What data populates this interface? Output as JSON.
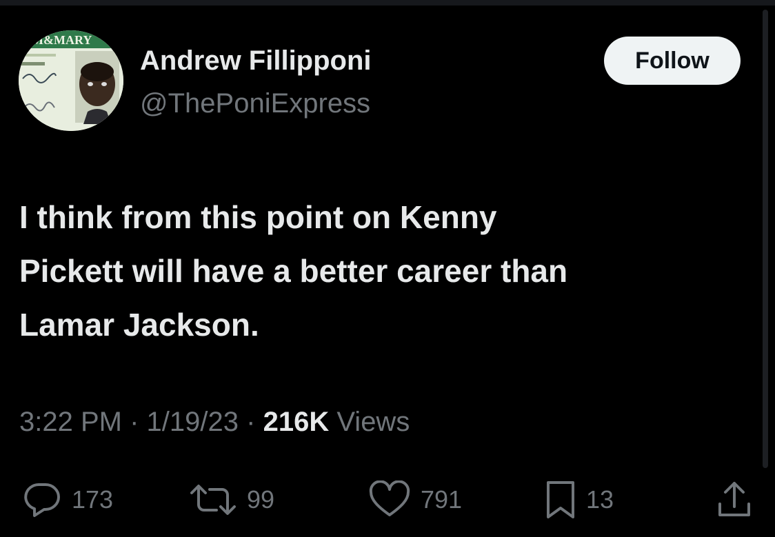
{
  "author": {
    "name": "Andrew Fillipponi",
    "handle": "@ThePoniExpress"
  },
  "avatar_card_text": "AM&MARY",
  "follow_label": "Follow",
  "tweet": {
    "text_lines": [
      "I think from this point on Kenny",
      "Pickett will have a better career than",
      "Lamar Jackson."
    ]
  },
  "meta": {
    "time": "3:22 PM",
    "separator": "·",
    "date": "1/19/23",
    "views_count": "216K",
    "views_label": "Views"
  },
  "actions": {
    "replies": "173",
    "reposts": "99",
    "likes": "791",
    "bookmarks": "13"
  },
  "colors": {
    "background": "#000000",
    "primary_text": "#e7e9ea",
    "secondary_text": "#71767b",
    "follow_bg": "#eff3f4"
  }
}
